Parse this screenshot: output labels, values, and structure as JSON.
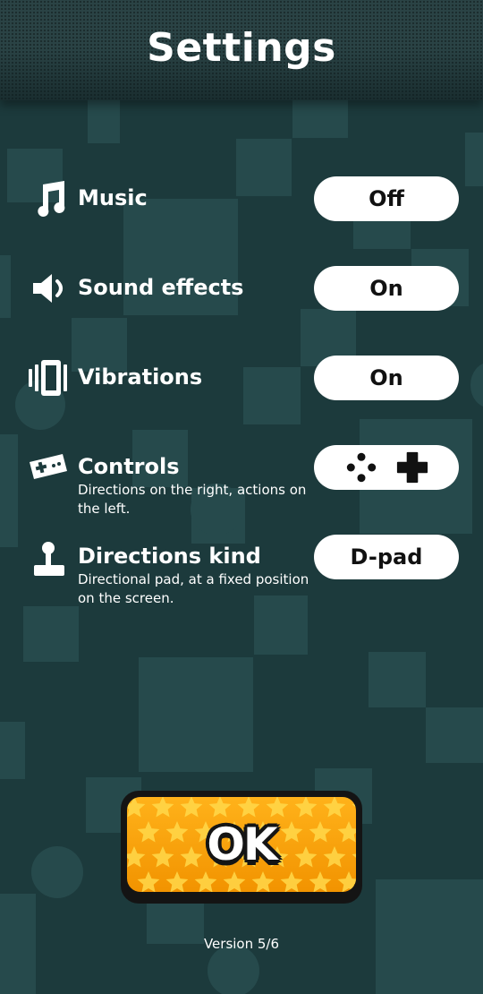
{
  "header": {
    "title": "Settings"
  },
  "settings": [
    {
      "label": "Music",
      "value": "Off",
      "icon": "music-note-icon"
    },
    {
      "label": "Sound effects",
      "value": "On",
      "icon": "speaker-icon"
    },
    {
      "label": "Vibrations",
      "value": "On",
      "icon": "vibration-icon"
    },
    {
      "label": "Controls",
      "description": "Directions on the right, actions on the left.",
      "value_icons": [
        "buttons-icon",
        "dpad-icon"
      ],
      "icon": "gamepad-icon"
    },
    {
      "label": "Directions kind",
      "description": "Directional pad, at a fixed position on the screen.",
      "value": "D-pad",
      "icon": "joystick-icon"
    }
  ],
  "ok_button": {
    "label": "OK"
  },
  "version": "Version 5/6",
  "colors": {
    "background": "#1c3a3c",
    "pill": "#ffffff",
    "ok_orange": "#f7a20d",
    "star": "#ffd84a"
  }
}
